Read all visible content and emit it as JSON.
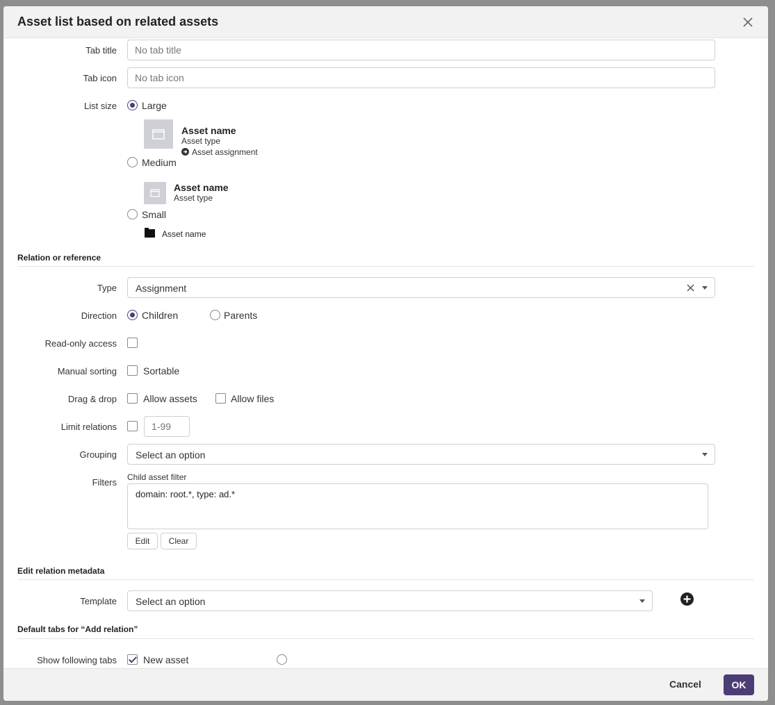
{
  "dialog": {
    "title": "Asset list based on related assets",
    "close_icon": "close-icon"
  },
  "general": {
    "tab_title_label": "Tab title",
    "tab_title_placeholder": "No tab title",
    "tab_icon_label": "Tab icon",
    "tab_icon_placeholder": "No tab icon",
    "list_size_label": "List size",
    "list_size_selected": "Large",
    "options": {
      "large": "Large",
      "medium": "Medium",
      "small": "Small"
    },
    "preview": {
      "asset_name": "Asset name",
      "asset_type": "Asset type",
      "asset_assignment": "Asset assignment"
    }
  },
  "relation": {
    "section_title": "Relation or reference",
    "type_label": "Type",
    "type_value": "Assignment",
    "direction_label": "Direction",
    "direction_children": "Children",
    "direction_parents": "Parents",
    "direction_selected": "Children",
    "readonly_label": "Read-only access",
    "manual_sorting_label": "Manual sorting",
    "sortable_label": "Sortable",
    "drag_drop_label": "Drag & drop",
    "allow_assets_label": "Allow assets",
    "allow_files_label": "Allow files",
    "limit_relations_label": "Limit relations",
    "limit_placeholder": "1-99",
    "grouping_label": "Grouping",
    "grouping_value": "Select an option",
    "filters_label": "Filters",
    "child_filter_label": "Child asset filter",
    "child_filter_value": "domain: root.*, type: ad.*",
    "edit_label": "Edit",
    "clear_label": "Clear"
  },
  "metadata": {
    "section_title": "Edit relation metadata",
    "template_label": "Template",
    "template_value": "Select an option"
  },
  "default_tabs": {
    "section_title": "Default tabs for “Add relation”",
    "show_tabs_label": "Show following tabs",
    "new_asset_label": "New asset"
  },
  "footer": {
    "cancel_label": "Cancel",
    "ok_label": "OK"
  },
  "colors": {
    "accent": "#4d3d75",
    "header_bg": "#f2f2f2"
  }
}
